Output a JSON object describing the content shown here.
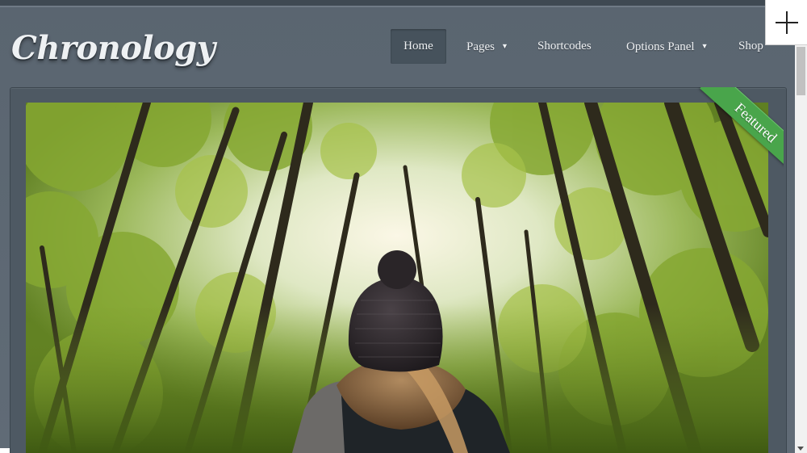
{
  "site": {
    "logo_text": "Chronology"
  },
  "nav": {
    "items": [
      {
        "label": "Home",
        "active": true
      },
      {
        "label": "Pages",
        "dropdown": true
      },
      {
        "label": "Shortcodes"
      },
      {
        "label": "Options Panel",
        "dropdown": true
      },
      {
        "label": "Shop"
      }
    ],
    "caret_glyph": "▼"
  },
  "featured": {
    "ribbon_label": "Featured",
    "image_subject": "person in knit hat looking up at forest canopy"
  },
  "colors": {
    "header_bg": "#5d6873",
    "active_nav_bg": "#46525c",
    "ribbon_green": "#49a54b",
    "panel_bg": "#4e5963"
  },
  "icons": {
    "add": "plus-icon"
  }
}
